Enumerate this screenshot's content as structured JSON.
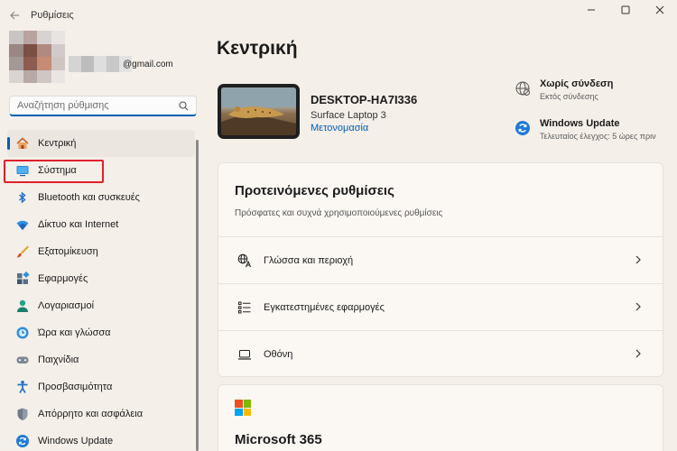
{
  "window": {
    "title": "Ρυθμίσεις"
  },
  "profile": {
    "email_suffix": "@gmail.com"
  },
  "search": {
    "placeholder": "Αναζήτηση ρύθμισης"
  },
  "sidebar": {
    "items": [
      {
        "label": "Κεντρική",
        "icon": "home-icon",
        "active": true
      },
      {
        "label": "Σύστημα",
        "icon": "system-icon",
        "active": false
      },
      {
        "label": "Bluetooth και συσκευές",
        "icon": "bluetooth-icon",
        "active": false
      },
      {
        "label": "Δίκτυο και Internet",
        "icon": "wifi-icon",
        "active": false
      },
      {
        "label": "Εξατομίκευση",
        "icon": "brush-icon",
        "active": false
      },
      {
        "label": "Εφαρμογές",
        "icon": "apps-icon",
        "active": false
      },
      {
        "label": "Λογαριασμοί",
        "icon": "person-icon",
        "active": false
      },
      {
        "label": "Ώρα και γλώσσα",
        "icon": "clock-globe-icon",
        "active": false
      },
      {
        "label": "Παιχνίδια",
        "icon": "gamepad-icon",
        "active": false
      },
      {
        "label": "Προσβασιμότητα",
        "icon": "accessibility-icon",
        "active": false
      },
      {
        "label": "Απόρρητο και ασφάλεια",
        "icon": "shield-icon",
        "active": false
      },
      {
        "label": "Windows Update",
        "icon": "update-icon",
        "active": false
      }
    ]
  },
  "main": {
    "title": "Κεντρική",
    "device": {
      "name": "DESKTOP-HA7I336",
      "model": "Surface Laptop 3",
      "rename_label": "Μετονομασία"
    },
    "status": [
      {
        "title": "Χωρίς σύνδεση",
        "subtitle": "Εκτός σύνδεσης",
        "icon": "globe-icon"
      },
      {
        "title": "Windows Update",
        "subtitle": "Τελευταίος έλεγχος: 5 ώρες πριν",
        "icon": "update-icon"
      }
    ],
    "recommended": {
      "title": "Προτεινόμενες ρυθμίσεις",
      "subtitle": "Πρόσφατες και συχνά χρησιμοποιούμενες ρυθμίσεις",
      "rows": [
        {
          "label": "Γλώσσα και περιοχή",
          "icon": "language-icon"
        },
        {
          "label": "Εγκατεστημένες εφαρμογές",
          "icon": "list-icon"
        },
        {
          "label": "Οθόνη",
          "icon": "laptop-icon"
        }
      ]
    },
    "m365": {
      "title": "Microsoft 365"
    }
  },
  "colors": {
    "accent": "#005fb8",
    "highlight": "#e0202a",
    "background": "#f4efe9"
  }
}
